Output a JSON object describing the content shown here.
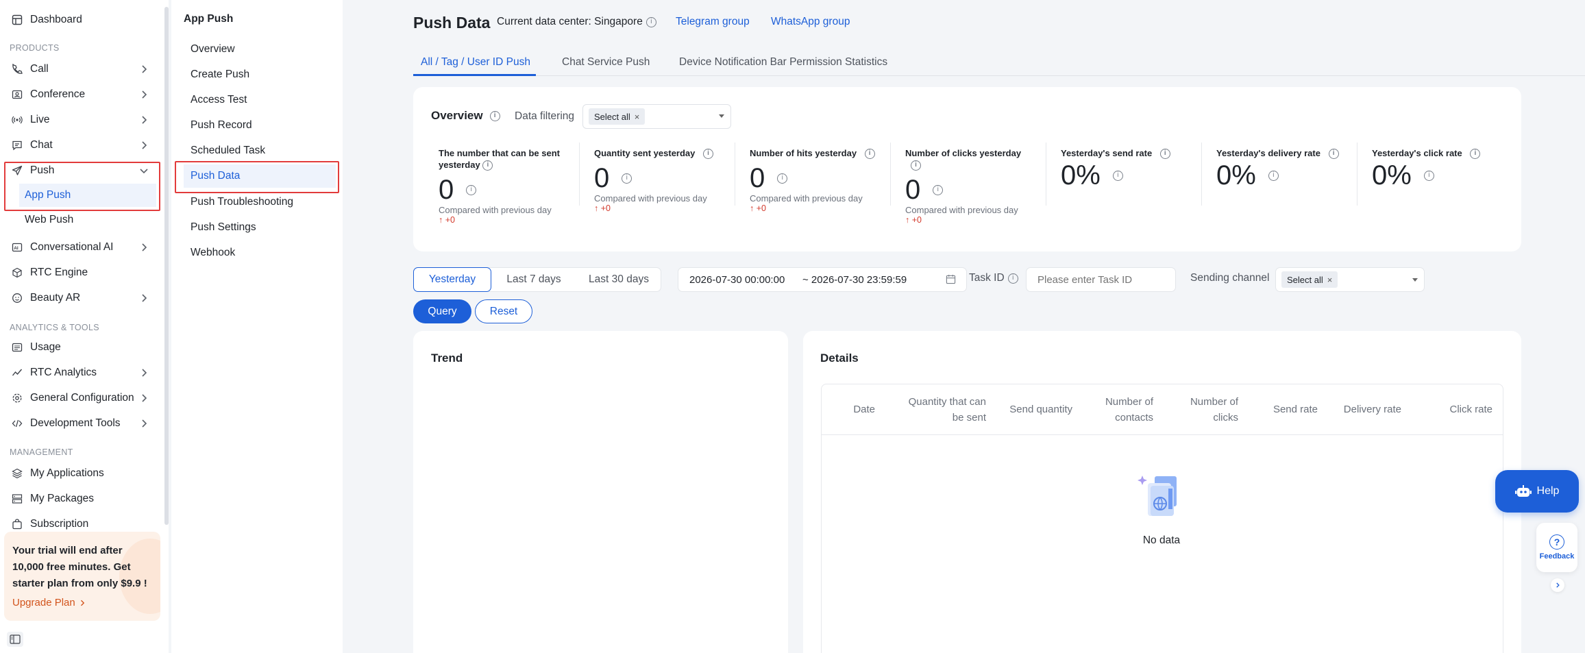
{
  "sidebar": {
    "dashboard": "Dashboard",
    "products_label": "PRODUCTS",
    "call": "Call",
    "conference": "Conference",
    "live": "Live",
    "chat": "Chat",
    "push": "Push",
    "app_push": "App Push",
    "web_push": "Web Push",
    "conversational_ai": "Conversational AI",
    "rtc_engine": "RTC Engine",
    "beauty_ar": "Beauty AR",
    "analytics_label": "ANALYTICS & TOOLS",
    "usage": "Usage",
    "rtc_analytics": "RTC Analytics",
    "general_configuration": "General Configuration",
    "development_tools": "Development Tools",
    "management_label": "MANAGEMENT",
    "my_applications": "My Applications",
    "my_packages": "My Packages",
    "subscription": "Subscription",
    "trial_text": "Your trial will end after 10,000 free minutes. Get starter plan from only $9.9 !",
    "upgrade": "Upgrade Plan"
  },
  "panel2": {
    "title": "App Push",
    "items": [
      "Overview",
      "Create Push",
      "Access Test",
      "Push Record",
      "Scheduled Task",
      "Push Data",
      "Push Troubleshooting",
      "Push Settings",
      "Webhook"
    ]
  },
  "header": {
    "title": "Push Data",
    "data_center": "Current data center: Singapore",
    "telegram": "Telegram group",
    "whatsapp": "WhatsApp group"
  },
  "tabs": [
    "All / Tag / User ID Push",
    "Chat Service Push",
    "Device Notification Bar Permission Statistics"
  ],
  "overview": {
    "title": "Overview",
    "filter_label": "Data filtering",
    "filter_tag": "Select all",
    "metrics": [
      {
        "title": "The number that can be sent yesterday",
        "value": "0",
        "compare": "Compared with previous day",
        "delta": "+0"
      },
      {
        "title": "Quantity sent yesterday",
        "value": "0",
        "compare": "Compared with previous day",
        "delta": "+0"
      },
      {
        "title": "Number of hits yesterday",
        "value": "0",
        "compare": "Compared with previous day",
        "delta": "+0"
      },
      {
        "title": "Number of clicks yesterday",
        "value": "0",
        "compare": "Compared with previous day",
        "delta": "+0"
      },
      {
        "title": "Yesterday's send rate",
        "value": "0%"
      },
      {
        "title": "Yesterday's delivery rate",
        "value": "0%"
      },
      {
        "title": "Yesterday's click rate",
        "value": "0%"
      }
    ]
  },
  "filters": {
    "range_options": [
      "Yesterday",
      "Last 7 days",
      "Last 30 days"
    ],
    "start": "2026-07-30 00:00:00",
    "end": "~ 2026-07-30 23:59:59",
    "task_id_label": "Task ID",
    "task_id_placeholder": "Please enter Task ID",
    "channel_label": "Sending channel",
    "channel_tag": "Select all",
    "query": "Query",
    "reset": "Reset"
  },
  "trend": {
    "title": "Trend"
  },
  "details": {
    "title": "Details",
    "columns": [
      "Date",
      "Quantity that can be sent",
      "Send quantity",
      "Number of contacts",
      "Number of clicks",
      "Send rate",
      "Delivery rate",
      "Click rate"
    ],
    "empty": "No data"
  },
  "help": {
    "label": "Help",
    "feedback": "Feedback"
  },
  "colors": {
    "accent": "#1d5fd8",
    "highlight": "#e23b3b",
    "delta": "#d33a2c"
  }
}
